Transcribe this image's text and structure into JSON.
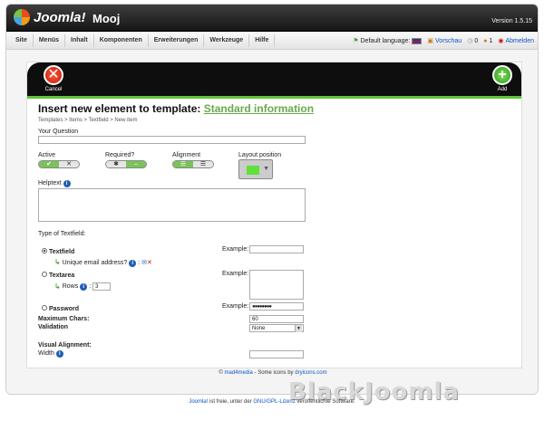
{
  "header": {
    "logo_text": "Joomla!",
    "site_name": "Mooj",
    "version": "Version 1.5.15"
  },
  "menu": {
    "items": [
      "Site",
      "Menüs",
      "Inhalt",
      "Komponenten",
      "Erweiterungen",
      "Werkzeuge",
      "Hilfe"
    ]
  },
  "status": {
    "default_language": "Default language:",
    "preview": "Vorschau",
    "messages_count": "0",
    "users_count": "1",
    "logout": "Abmelden"
  },
  "toolbar": {
    "cancel_label": "Cancel",
    "add_label": "Add"
  },
  "form": {
    "title_prefix": "Insert new element to template:",
    "title_link": "Standard information",
    "breadcrumb": "Templates > Items > Textfield > New item",
    "question_label": "Your Question",
    "question_value": "",
    "active_label": "Active",
    "required_label": "Required?",
    "alignment_label": "Alignment",
    "layout_label": "Layout position",
    "helptext_label": "Helptext",
    "helptext_value": "",
    "type_label": "Type of Textfield:",
    "opt_textfield": "Textfield",
    "opt_unique": "Unique email address?",
    "opt_textarea": "Textarea",
    "rows_label": "Rows",
    "rows_value": "3",
    "opt_password": "Password",
    "example_label_1": "Example:",
    "example_label_2": "Example:",
    "example_label_3": "Example:",
    "password_example": "●●●●●●●●",
    "max_chars_label": "Maximum Chars:",
    "max_chars_value": "60",
    "validation_label": "Validation",
    "validation_value": "None",
    "visual_alignment_label": "Visual Alignment:",
    "width_label": "Width",
    "width_value": ""
  },
  "footer": {
    "credit_prefix": "mad4media",
    "credit_mid": " - Some icons by ",
    "credit_link": "dryicons.com",
    "bottom_joomla": "Joomla!",
    "bottom_text_1": " ist freie, unter der ",
    "bottom_license": "GNU/GPL-Lizenz",
    "bottom_text_2": " veröffentlichte Software."
  },
  "watermark": "BlackJoomla",
  "colors": {
    "accent_green": "#6aa84f",
    "toolbar_bg": "#0e0e0e",
    "link_blue": "#0b55c4"
  }
}
